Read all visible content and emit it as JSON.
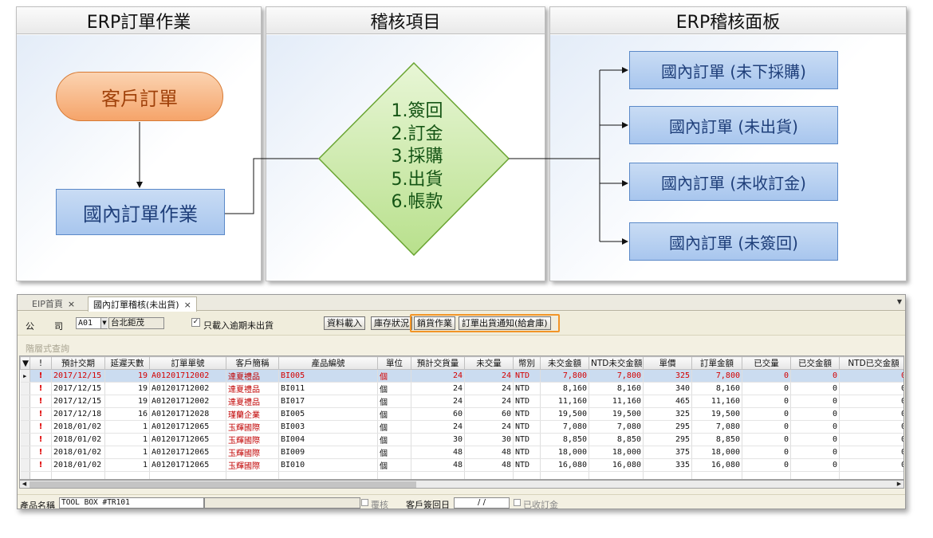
{
  "diagram": {
    "panels": [
      "ERP訂單作業",
      "稽核項目",
      "ERP稽核面板"
    ],
    "customer_order": "客戶訂單",
    "domestic_order": "國內訂單作業",
    "audit_items": [
      "1.簽回",
      "2.訂金",
      "3.採購",
      "5.出貨",
      "6.帳款"
    ],
    "results": [
      "國內訂單 (未下採購)",
      "國內訂單 (未出貨)",
      "國內訂單 (未收訂金)",
      "國內訂單 (未簽回)"
    ],
    "colors": {
      "pill": "#f5a46a",
      "box": "#a8c6ee",
      "diamond": "#b8e08c"
    }
  },
  "erp": {
    "tabs": [
      {
        "label": "EIP首頁",
        "close": "×"
      },
      {
        "label": "國內訂單稽核(未出貨)",
        "close": "×"
      }
    ],
    "toolbar": {
      "company_label_1": "公",
      "company_label_2": "司",
      "company_code": "A01",
      "company_name": "台北鉅茂",
      "overdue_only_label": "只載入逾期未出貨",
      "overdue_only_checked": "✓",
      "load_button": "資料載入",
      "stock_button": "庫存狀況",
      "sales_button": "銷貨作業",
      "ship_notice_button": "訂單出貨通知(給倉庫)",
      "highlight_color": "#f29527"
    },
    "group_hint": "階層式查詢",
    "grid": {
      "columns": [
        "",
        "!",
        "預計交期",
        "延遲天數",
        "訂單單號",
        "客戶簡稱",
        "產品編號",
        "單位",
        "預計交貨量",
        "未交量",
        "幣別",
        "未交金額",
        "NTD未交金額",
        "單價",
        "訂單金額",
        "已交量",
        "已交金額",
        "NTD已交金額"
      ],
      "rows": [
        {
          "marker": "▶",
          "flag": "!",
          "cells": [
            "2017/12/15",
            "19",
            "A01201712002",
            "達夏禮品",
            "BI005",
            "個",
            "24",
            "24",
            "NTD",
            "7,800",
            "7,800",
            "325",
            "7,800",
            "0",
            "0",
            "0"
          ]
        },
        {
          "marker": "",
          "flag": "!",
          "cells": [
            "2017/12/15",
            "19",
            "A01201712002",
            "達夏禮品",
            "BI011",
            "個",
            "24",
            "24",
            "NTD",
            "8,160",
            "8,160",
            "340",
            "8,160",
            "0",
            "0",
            "0"
          ]
        },
        {
          "marker": "",
          "flag": "!",
          "cells": [
            "2017/12/15",
            "19",
            "A01201712002",
            "達夏禮品",
            "BI017",
            "個",
            "24",
            "24",
            "NTD",
            "11,160",
            "11,160",
            "465",
            "11,160",
            "0",
            "0",
            "0"
          ]
        },
        {
          "marker": "",
          "flag": "!",
          "cells": [
            "2017/12/18",
            "16",
            "A01201712028",
            "瑾蘭企業",
            "BI005",
            "個",
            "60",
            "60",
            "NTD",
            "19,500",
            "19,500",
            "325",
            "19,500",
            "0",
            "0",
            "0"
          ]
        },
        {
          "marker": "",
          "flag": "!",
          "cells": [
            "2018/01/02",
            "1",
            "A01201712065",
            "玉輝國際",
            "BI003",
            "個",
            "24",
            "24",
            "NTD",
            "7,080",
            "7,080",
            "295",
            "7,080",
            "0",
            "0",
            "0"
          ]
        },
        {
          "marker": "",
          "flag": "!",
          "cells": [
            "2018/01/02",
            "1",
            "A01201712065",
            "玉輝國際",
            "BI004",
            "個",
            "30",
            "30",
            "NTD",
            "8,850",
            "8,850",
            "295",
            "8,850",
            "0",
            "0",
            "0"
          ]
        },
        {
          "marker": "",
          "flag": "!",
          "cells": [
            "2018/01/02",
            "1",
            "A01201712065",
            "玉輝國際",
            "BI009",
            "個",
            "48",
            "48",
            "NTD",
            "18,000",
            "18,000",
            "375",
            "18,000",
            "0",
            "0",
            "0"
          ]
        },
        {
          "marker": "",
          "flag": "!",
          "cells": [
            "2018/01/02",
            "1",
            "A01201712065",
            "玉輝國際",
            "BI010",
            "個",
            "48",
            "48",
            "NTD",
            "16,080",
            "16,080",
            "335",
            "16,080",
            "0",
            "0",
            "0"
          ]
        }
      ],
      "selected_row": 0,
      "scroll_left_icon": "scroll-left-arrow-icon",
      "scroll_right_icon": "scroll-right-arrow-icon"
    },
    "status": {
      "product_label": "產品名稱",
      "product_name": "TOOL BOX #TR101",
      "audit_label": "覆核",
      "sign_date_label": "客戶簽回日",
      "sign_date_value": "/   /",
      "deposit_label": "已收訂金"
    }
  }
}
